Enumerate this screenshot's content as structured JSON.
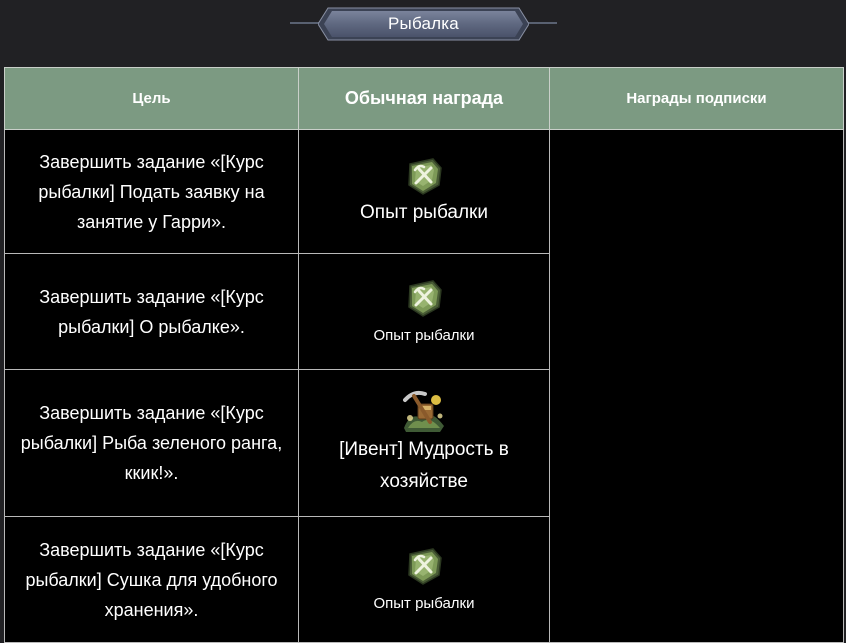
{
  "banner": {
    "title": "Рыбалка"
  },
  "table": {
    "headers": {
      "goal": "Цель",
      "normal_reward": "Обычная награда",
      "subscription_reward": "Награды подписки"
    },
    "rows": [
      {
        "goal": "Завершить задание «[Курс рыбалки] Подать заявку на занятие у Гарри».",
        "reward_label": "Опыт рыбалки",
        "reward_icon": "fishing-exp-icon"
      },
      {
        "goal": "Завершить задание «[Курс рыбалки] О рыбалке».",
        "reward_label": "Опыт рыбалки",
        "reward_icon": "fishing-exp-icon"
      },
      {
        "goal": "Завершить задание «[Курс рыбалки] Рыба зеленого ранга, ккик!».",
        "reward_label": "[Ивент] Мудрость в хозяйстве",
        "reward_icon": "household-wisdom-icon"
      },
      {
        "goal": "Завершить задание «[Курс рыбалки] Сушка для удобного хранения».",
        "reward_label": "Опыт рыбалки",
        "reward_icon": "fishing-exp-icon"
      }
    ]
  },
  "colors": {
    "page_background": "#212124",
    "header_background": "#7c9a82",
    "cell_background": "#000000",
    "banner_plate": "#5f6880",
    "text": "#ffffff"
  }
}
